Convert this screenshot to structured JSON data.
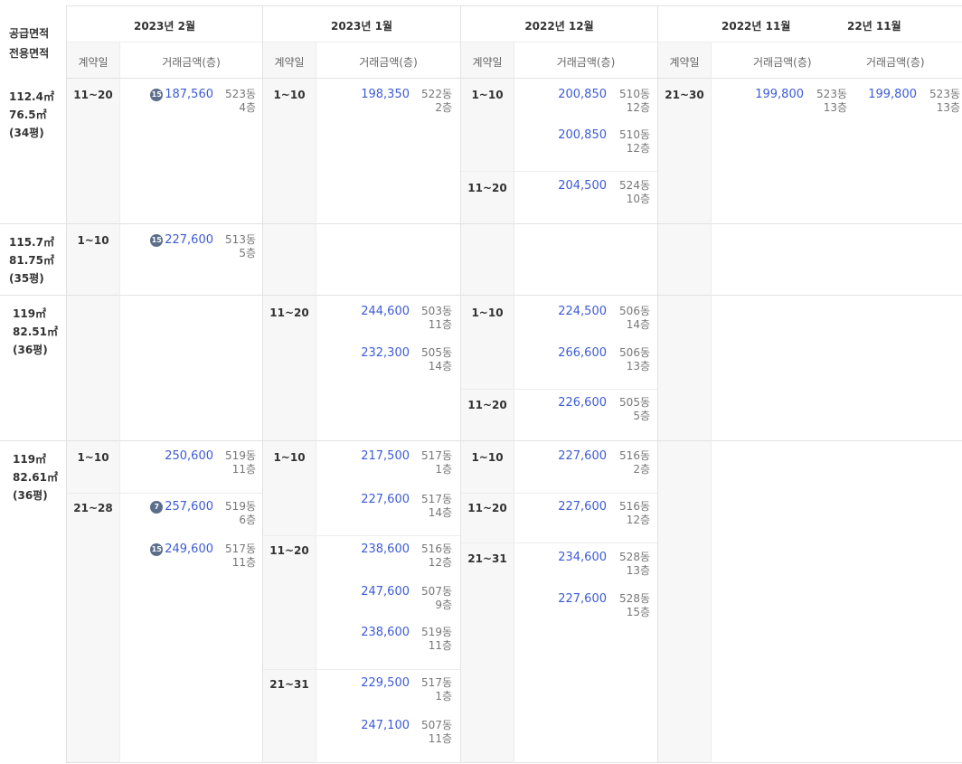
{
  "header": {
    "area_label_1": "공급면적",
    "area_label_2": "전용면적",
    "months": [
      {
        "label": "2023년 2월"
      },
      {
        "label": "2023년 1월"
      },
      {
        "label": "2022년 12월"
      },
      {
        "label": "2022년 11월"
      },
      {
        "label": "22년 11월"
      }
    ],
    "day_col": "계약일",
    "price_col": "거래금액(층)"
  },
  "rows": [
    {
      "supply": "112.4㎡",
      "exclusive": "76.5㎡",
      "pyeong": "(34평)"
    },
    {
      "supply": "115.7㎡",
      "exclusive": "81.75㎡",
      "pyeong": "(35평)"
    },
    {
      "supply": "119㎡",
      "exclusive": "82.51㎡",
      "pyeong": "(36평)"
    },
    {
      "supply": "119㎡",
      "exclusive": "82.61㎡",
      "pyeong": "(36평)"
    }
  ],
  "days": {
    "d1": "11~20",
    "d2": "1~10",
    "d3": "1~10",
    "d4": "11~20",
    "d5": "21~30",
    "d6": "1~10",
    "d7": "11~20",
    "d8": "1~10",
    "d9": "11~20",
    "d10": "1~10",
    "d11": "21~28",
    "d12": "1~10",
    "d13": "11~20",
    "d14": "21~31",
    "d15": "1~10",
    "d16": "11~20",
    "d17": "21~31"
  },
  "trades": {
    "t1": {
      "price": "187,560",
      "dong": "523동",
      "floor": "4층",
      "badge": "15"
    },
    "t2": {
      "price": "198,350",
      "dong": "522동",
      "floor": "2층"
    },
    "t3": {
      "price": "200,850",
      "dong": "510동",
      "floor": "12층"
    },
    "t4": {
      "price": "200,850",
      "dong": "510동",
      "floor": "12층"
    },
    "t5": {
      "price": "204,500",
      "dong": "524동",
      "floor": "10층"
    },
    "t6": {
      "price": "199,800",
      "dong": "523동",
      "floor": "13층"
    },
    "t7": {
      "price": "199,800",
      "dong": "523동",
      "floor": "13층"
    },
    "t8": {
      "price": "227,600",
      "dong": "513동",
      "floor": "5층",
      "badge": "15"
    },
    "t9": {
      "price": "244,600",
      "dong": "503동",
      "floor": "11층"
    },
    "t10": {
      "price": "232,300",
      "dong": "505동",
      "floor": "14층"
    },
    "t11": {
      "price": "224,500",
      "dong": "506동",
      "floor": "14층"
    },
    "t12": {
      "price": "266,600",
      "dong": "506동",
      "floor": "13층"
    },
    "t13": {
      "price": "226,600",
      "dong": "505동",
      "floor": "5층"
    },
    "t14": {
      "price": "250,600",
      "dong": "519동",
      "floor": "11층"
    },
    "t15": {
      "price": "257,600",
      "dong": "519동",
      "floor": "6층",
      "badge": "7"
    },
    "t16": {
      "price": "249,600",
      "dong": "517동",
      "floor": "11층",
      "badge": "15"
    },
    "t17": {
      "price": "217,500",
      "dong": "517동",
      "floor": "1층"
    },
    "t18": {
      "price": "227,600",
      "dong": "517동",
      "floor": "14층"
    },
    "t19": {
      "price": "238,600",
      "dong": "516동",
      "floor": "12층"
    },
    "t20": {
      "price": "247,600",
      "dong": "507동",
      "floor": "9층"
    },
    "t21": {
      "price": "238,600",
      "dong": "519동",
      "floor": "11층"
    },
    "t22": {
      "price": "229,500",
      "dong": "517동",
      "floor": "1층"
    },
    "t23": {
      "price": "247,100",
      "dong": "507동",
      "floor": "11층"
    },
    "t24": {
      "price": "227,600",
      "dong": "516동",
      "floor": "2층"
    },
    "t25": {
      "price": "227,600",
      "dong": "516동",
      "floor": "12층"
    },
    "t26": {
      "price": "234,600",
      "dong": "528동",
      "floor": "13층"
    },
    "t27": {
      "price": "227,600",
      "dong": "528동",
      "floor": "15층"
    }
  }
}
